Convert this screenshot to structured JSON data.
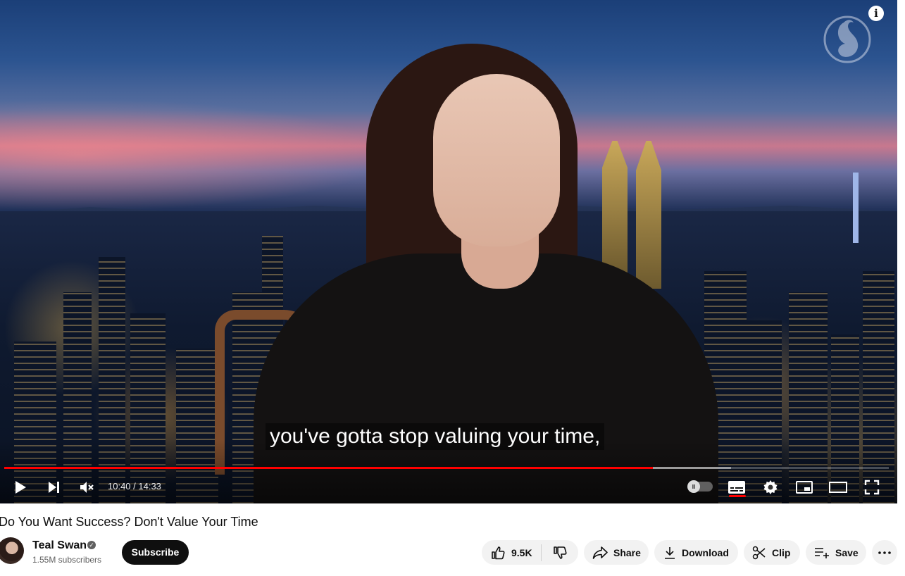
{
  "player": {
    "caption": "you've gotta stop valuing your time,",
    "info_icon_glyph": "i",
    "time_current": "10:40",
    "time_separator": "/",
    "time_total": "14:33",
    "timecode_text": "10:40 / 14:33",
    "progress_played_fraction": 0.733,
    "progress_loaded_fraction": 0.822,
    "autoplay_knob_glyph": "II",
    "accent_color": "#ff0000",
    "icons": [
      "play-icon",
      "next-icon",
      "mute-icon",
      "autoplay-toggle",
      "subtitles-icon",
      "settings-icon",
      "miniplayer-icon",
      "theater-icon",
      "fullscreen-icon"
    ]
  },
  "video": {
    "title": "Do You Want Success? Don't Value Your Time"
  },
  "channel": {
    "name": "Teal Swan",
    "verified_glyph": "✓",
    "subscribers": "1.55M subscribers",
    "subscribe_label": "Subscribe"
  },
  "actions": {
    "likes": "9.5K",
    "share_label": "Share",
    "download_label": "Download",
    "clip_label": "Clip",
    "save_label": "Save"
  }
}
